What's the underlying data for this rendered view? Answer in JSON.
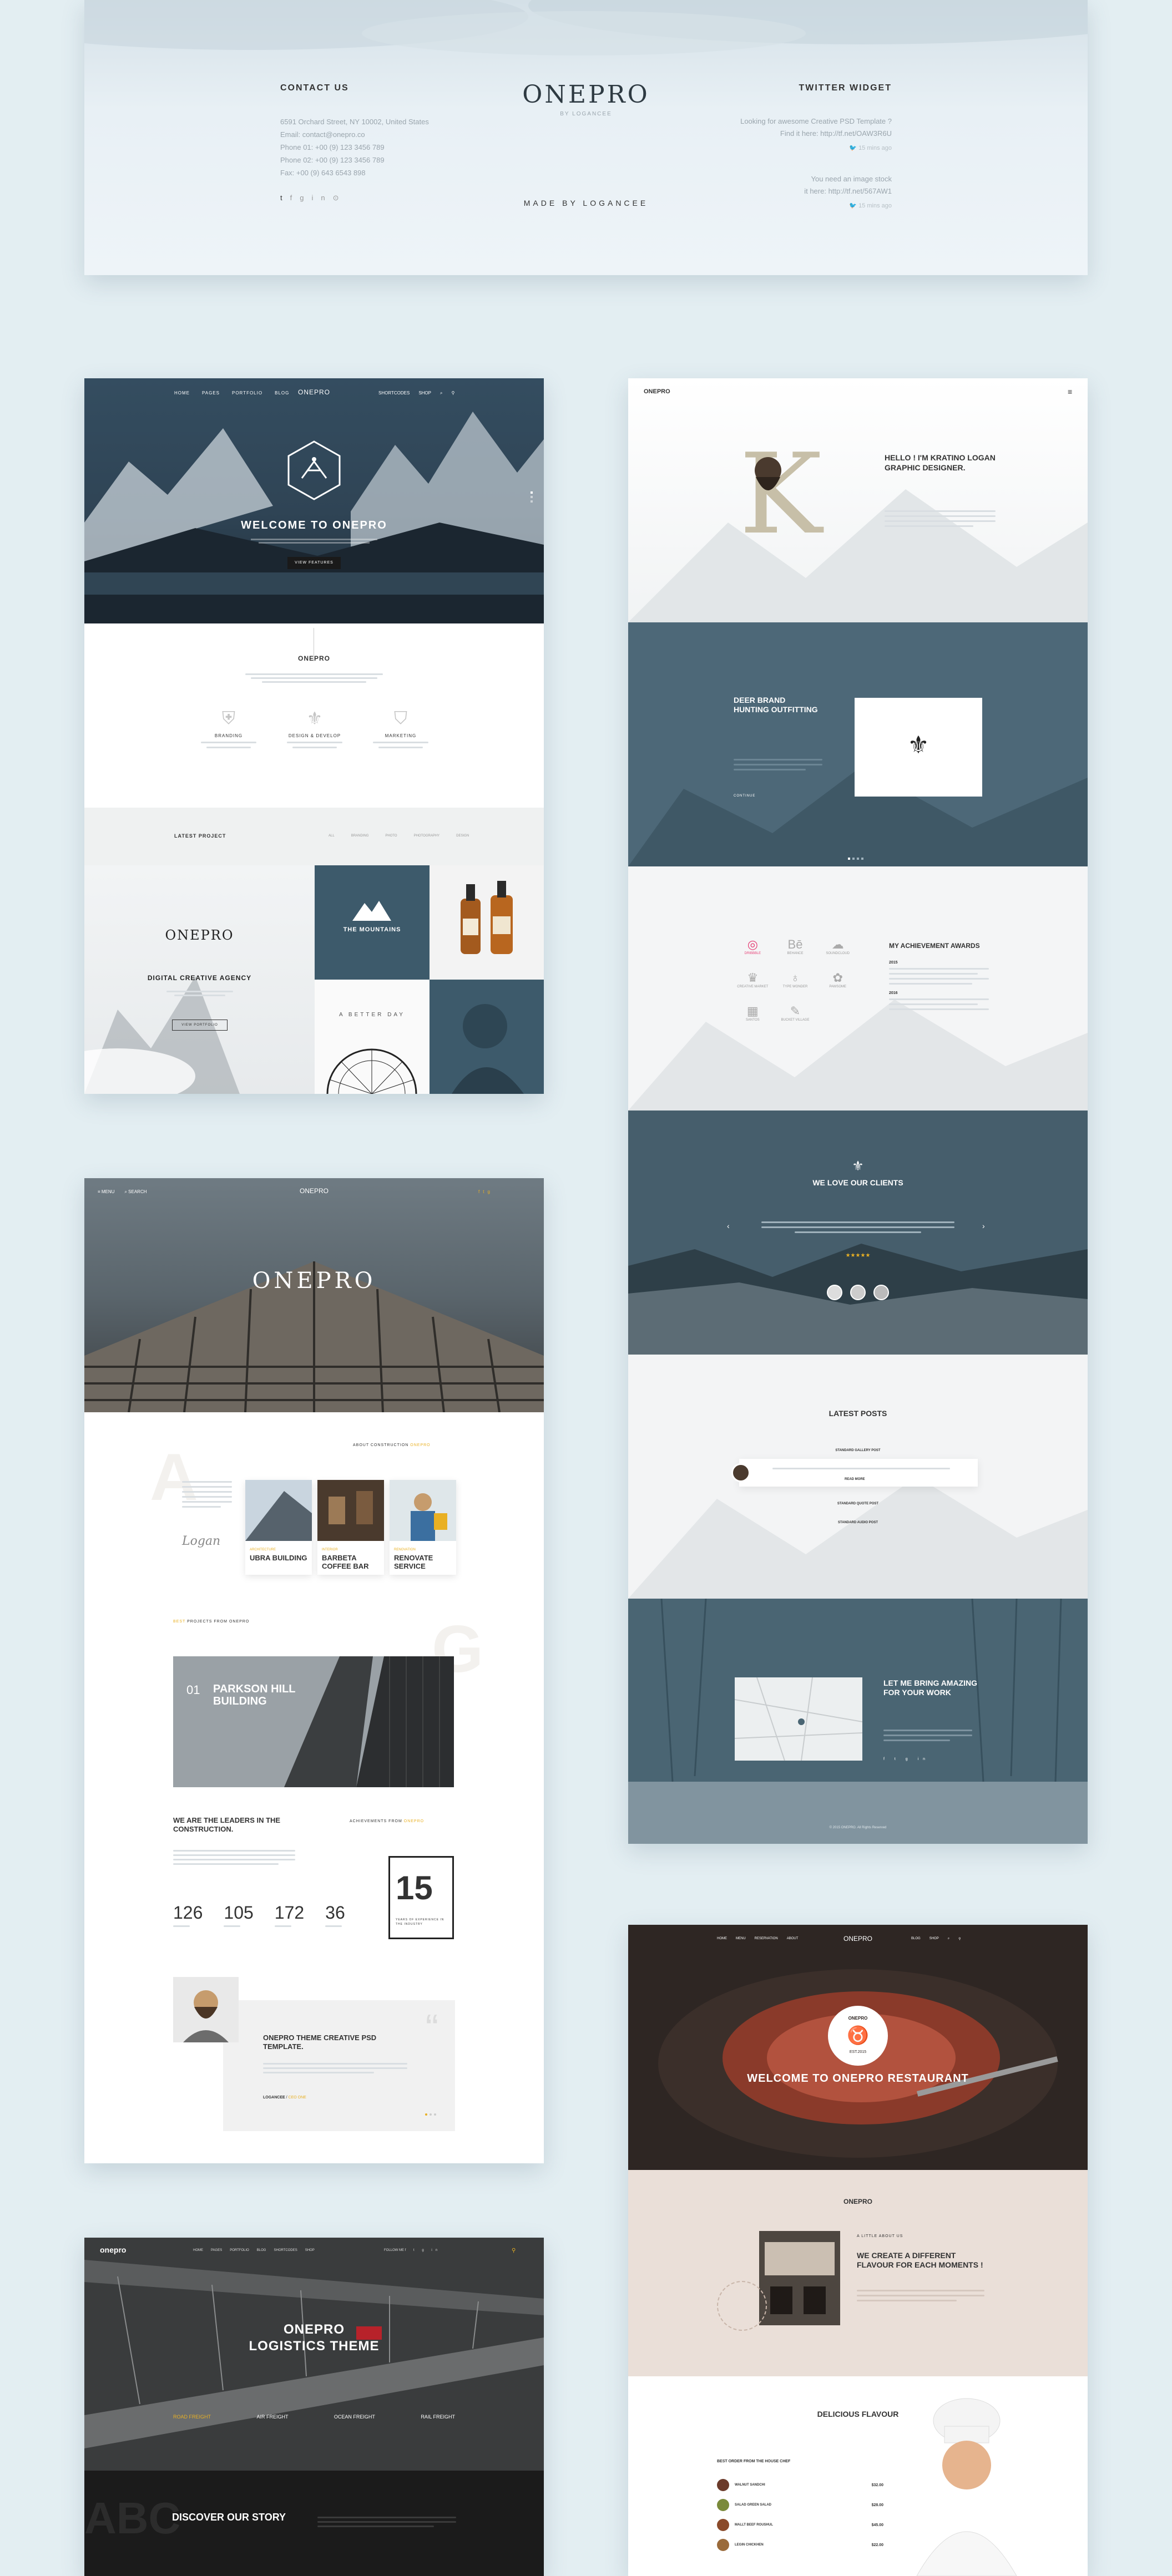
{
  "footer": {
    "contact_title": "CONTACT US",
    "address": "6591 Orchard Street, NY 10002, United States",
    "email": "Email: contact@onepro.co",
    "phone1": "Phone 01: +00 (9) 123 3456 789",
    "phone2": "Phone 02: +00 (9) 123 3456 789",
    "fax": "Fax: +00 (9) 643 6543 898",
    "logo": "ONEPRO",
    "logo_sub": "BY LOGANCEE",
    "made_by": "MADE BY LOGANCEE",
    "twitter_title": "TWITTER WIDGET",
    "tweet1": "Looking for awesome Creative PSD Template ?",
    "tweet1b": "Find it here: http://tf.net/OAW3R6U",
    "tweet1_time": "15 mins ago",
    "tweet2": "You need an image stock",
    "tweet2b": "it here: http://tf.net/567AW1",
    "tweet2_time": "15 mins ago"
  },
  "home": {
    "nav": [
      "HOME",
      "PAGES",
      "PORTFOLIO",
      "BLOG"
    ],
    "nav_right": [
      "SHORTCODES",
      "SHOP"
    ],
    "logo": "ONEPRO",
    "hero_title": "WELCOME TO ONEPRO",
    "hero_btn": "VIEW FEATURES",
    "section_title": "ONEPRO",
    "features": [
      "BRANDING",
      "DESIGN & DEVELOP",
      "MARKETING"
    ],
    "latest_title": "LATEST PROJECT",
    "filters": [
      "ALL",
      "BRANDING",
      "PHOTO",
      "PHOTOGRAPHY",
      "DESIGN"
    ],
    "agency_logo": "ONEPRO",
    "agency_title": "DIGITAL CREATIVE AGENCY",
    "agency_btn": "VIEW PORTFOLIO",
    "mountains": "THE MOUNTAINS",
    "better_day": "A BETTER DAY"
  },
  "arch": {
    "menu": "MENU",
    "search": "SEARCH",
    "logo": "ONEPRO",
    "hero_title": "ONEPRO",
    "about_label": "ABOUT CONSTRUCTION",
    "about_hl": "ONEPRO",
    "letter_a": "A",
    "letter_g": "G",
    "projects": [
      {
        "name": "UBRA BUILDING",
        "label": "ARCHITECTURE"
      },
      {
        "name": "BARBETA COFFEE BAR",
        "label": "INTERIOR"
      },
      {
        "name": "RENOVATE SERVICE",
        "label": "RENOVATION"
      }
    ],
    "projects_label": "PROJECTS FROM ONEPRO",
    "projects_hl": "BEST",
    "featured_num": "01",
    "featured_title": "PARKSON HILL BUILDING",
    "leaders_title": "WE ARE THE LEADERS IN THE CONSTRUCTION.",
    "ach_label": "ACHIEVEMENTS FROM",
    "ach_hl": "ONEPRO",
    "stats": [
      {
        "value": "126"
      },
      {
        "value": "105"
      },
      {
        "value": "172"
      },
      {
        "value": "36"
      }
    ],
    "years": "15",
    "years_text": "YEARS OF EXPERIENCE IN THE INDUSTRY",
    "quote_title": "ONEPRO THEME CREATIVE PSD TEMPLATE.",
    "quote_author": "LOGANCEE",
    "quote_role": "CEO ONE",
    "quote_mark": "“"
  },
  "logistics": {
    "logo": "onepro",
    "nav": [
      "HOME",
      "PAGES",
      "PORTFOLIO",
      "BLOG",
      "SHORTCODES",
      "SHOP"
    ],
    "follow": "FOLLOW ME",
    "hero_title": "ONEPRO",
    "hero_sub": "LOGISTICS THEME",
    "services": [
      "ROAD FREIGHT",
      "AIR FREIGHT",
      "OCEAN FREIGHT",
      "RAIL FREIGHT"
    ],
    "ghost": "ABC",
    "story": "DISCOVER OUR STORY"
  },
  "resume": {
    "logo": "ONEPRO",
    "hello": "HELLO ! I'M KRATINO LOGAN GRAPHIC DESIGNER.",
    "big_letter": "K",
    "deer_title": "DEER BRAND HUNTING OUTFITTING",
    "deer_link": "CONTINUE",
    "awards_title": "MY ACHIEVEMENT AWARDS",
    "icon_labels": [
      "DRIBBBLE",
      "BEHANCE",
      "SOUNDCLOUD",
      "CREATIVE MARKET",
      "TYPE WONDER",
      "PAWSOME",
      "SANTOS",
      "BUCKET VILLAGE"
    ],
    "years": [
      "2015",
      "2016"
    ],
    "love_title": "WE LOVE OUR CLIENTS",
    "rating": "★★★★★",
    "posts_title": "LATEST POSTS",
    "posts": [
      "STANDARD GALLERY POST",
      "STANDARD QUOTE POST",
      "STANDARD AUDIO POST"
    ],
    "read_more": "READ MORE",
    "bring_title": "LET ME BRING AMAZING FOR YOUR WORK",
    "copyright": "© 2015 ONEPRO. All Rights Reserved"
  },
  "restaurant": {
    "logo": "ONEPRO",
    "nav": [
      "HOME",
      "MENU",
      "RESERVATION",
      "ABOUT",
      "BLOG",
      "SHOP"
    ],
    "badge_top": "ONEPRO",
    "badge_bottom": "EST.2015",
    "hero_title": "WELCOME TO ONEPRO RESTAURANT",
    "section_logo": "ONEPRO",
    "little": "A LITTLE ABOUT US",
    "flavour": "WE CREATE A DIFFERENT FLAVOUR FOR EACH MOMENTS !",
    "delicious": "DELICIOUS FLAVOUR",
    "best_order": "BEST ORDER FROM THE HOUSE CHEF",
    "menu": [
      {
        "name": "WALNUT SANDCHI",
        "price": "$32.00"
      },
      {
        "name": "SALAD GREEN SALAD",
        "price": "$28.00"
      },
      {
        "name": "MALLT BEEF ROUSHUL",
        "price": "$45.00"
      },
      {
        "name": "LEGIN CHICKHEN",
        "price": "$22.00"
      }
    ]
  },
  "colors": {
    "accent": "#e9b023",
    "slate": "#4d6878",
    "dark": "#2a2a2a",
    "beige": "#eadfd8",
    "red": "#d9534f"
  }
}
